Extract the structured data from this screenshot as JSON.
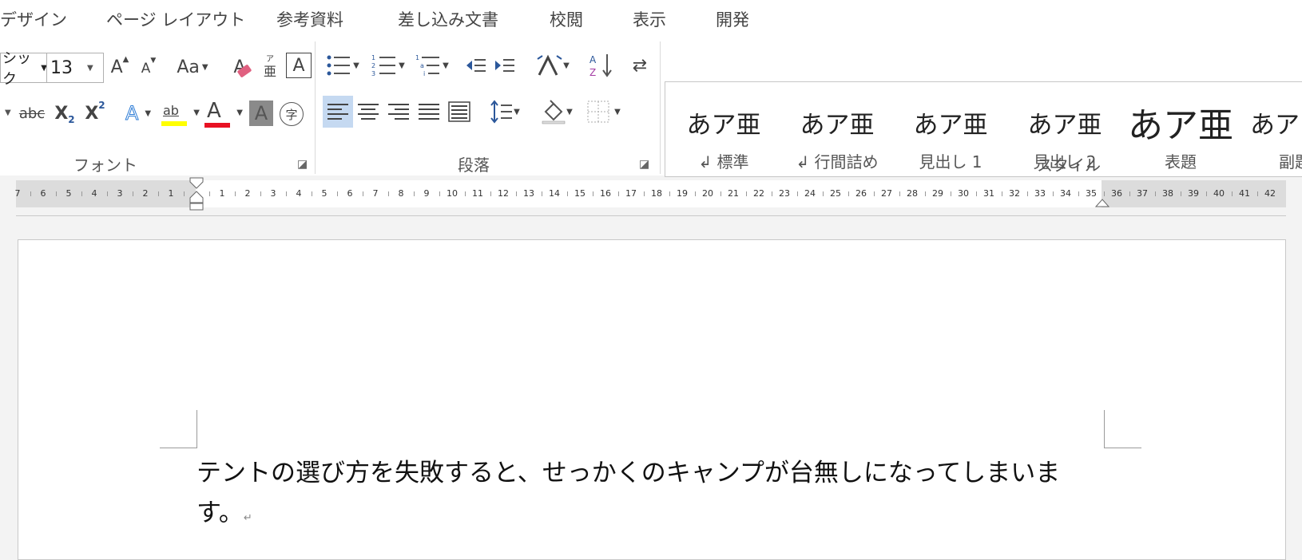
{
  "tabs": [
    "デザイン",
    "ページ レイアウト",
    "参考資料",
    "差し込み文書",
    "校閲",
    "表示",
    "開発"
  ],
  "font_group": {
    "label": "フォント",
    "font_name": "シック",
    "font_size": "13",
    "grow_label": "A",
    "shrink_label": "A",
    "change_case_label": "Aa",
    "clear_format_label": "A",
    "phonetic_label": "亜",
    "phonetic_ruby": "ア",
    "char_border_label": "A",
    "strike_label": "abc",
    "subscript_label": "X",
    "subscript_small": "2",
    "superscript_label": "X",
    "superscript_small": "2",
    "text_effect_label": "A",
    "highlight_label": "ab",
    "font_color_label": "A",
    "shading_label": "A",
    "enclosed_label": "字",
    "highlight_color": "#ffff00",
    "font_color": "#e81123"
  },
  "paragraph_group": {
    "label": "段落"
  },
  "styles_group": {
    "label": "スタイル",
    "items": [
      {
        "preview": "あア亜",
        "name": "↲ 標準"
      },
      {
        "preview": "あア亜",
        "name": "↲ 行間詰め"
      },
      {
        "preview": "あア亜",
        "name": "見出し 1"
      },
      {
        "preview": "あア亜",
        "name": "見出し 2"
      },
      {
        "preview": "あア亜",
        "name": "表題"
      },
      {
        "preview": "あア",
        "name": "副題"
      }
    ]
  },
  "ruler": {
    "left_numbers": [
      "7",
      "6",
      "5",
      "4",
      "3",
      "2",
      "1"
    ],
    "right_numbers": [
      "1",
      "2",
      "3",
      "4",
      "5",
      "6",
      "7",
      "8",
      "9",
      "10",
      "11",
      "12",
      "13",
      "14",
      "15",
      "16",
      "17",
      "18",
      "19",
      "20",
      "21",
      "22",
      "23",
      "24",
      "25",
      "26",
      "27",
      "28",
      "29",
      "30",
      "31",
      "32",
      "33",
      "34",
      "35",
      "36",
      "37",
      "38",
      "39",
      "40",
      "41",
      "42"
    ]
  },
  "document": {
    "text": "テントの選び方を失敗すると、せっかくのキャンプが台無しになってしまいます。",
    "paragraph_mark": "↵"
  },
  "colors": {
    "accent_selected": "#c5d9f1",
    "icon_blue": "#2b579a"
  }
}
